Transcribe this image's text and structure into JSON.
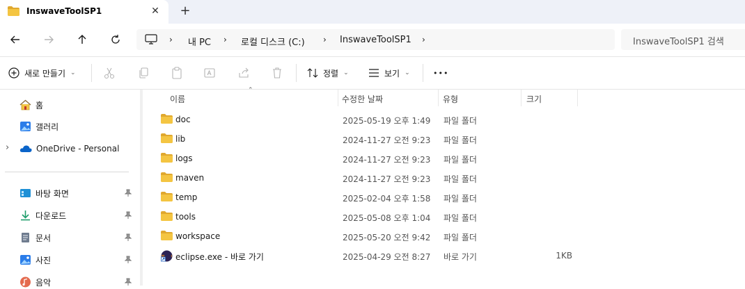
{
  "window": {
    "tab_title": "InswaveToolSP1",
    "close_glyph": "✕",
    "new_tab_glyph": "+"
  },
  "nav": {
    "breadcrumbs": [
      "내 PC",
      "로컬 디스크 (C:)",
      "InswaveToolSP1"
    ],
    "chevron": "›",
    "search_placeholder": "InswaveToolSP1 검색"
  },
  "toolbar": {
    "new_label": "새로 만들기",
    "sort_label": "정렬",
    "view_label": "보기",
    "more_glyph": "•••",
    "caret": "⌄"
  },
  "sidebar": {
    "items": [
      {
        "label": "홈",
        "icon": "home-icon"
      },
      {
        "label": "갤러리",
        "icon": "gallery-icon"
      },
      {
        "label": "OneDrive - Personal",
        "icon": "onedrive-icon"
      }
    ],
    "pinned": [
      {
        "label": "바탕 화면",
        "icon": "desktop-icon"
      },
      {
        "label": "다운로드",
        "icon": "download-icon"
      },
      {
        "label": "문서",
        "icon": "document-icon"
      },
      {
        "label": "사진",
        "icon": "pictures-icon"
      },
      {
        "label": "음악",
        "icon": "music-icon"
      }
    ],
    "expand_glyph": "›",
    "pin_glyph": "📌"
  },
  "columns": {
    "name": "이름",
    "modified": "수정한 날짜",
    "type": "유형",
    "size": "크기",
    "sort_glyph": "⌃"
  },
  "files": [
    {
      "name": "doc",
      "modified": "2025-05-19 오후 1:49",
      "type": "파일 폴더",
      "size": "",
      "icon": "folder-icon"
    },
    {
      "name": "lib",
      "modified": "2024-11-27 오전 9:23",
      "type": "파일 폴더",
      "size": "",
      "icon": "folder-icon"
    },
    {
      "name": "logs",
      "modified": "2024-11-27 오전 9:23",
      "type": "파일 폴더",
      "size": "",
      "icon": "folder-icon"
    },
    {
      "name": "maven",
      "modified": "2024-11-27 오전 9:23",
      "type": "파일 폴더",
      "size": "",
      "icon": "folder-icon"
    },
    {
      "name": "temp",
      "modified": "2025-02-04 오후 1:58",
      "type": "파일 폴더",
      "size": "",
      "icon": "folder-icon"
    },
    {
      "name": "tools",
      "modified": "2025-05-08 오후 1:04",
      "type": "파일 폴더",
      "size": "",
      "icon": "folder-icon"
    },
    {
      "name": "workspace",
      "modified": "2025-05-20 오전 9:42",
      "type": "파일 폴더",
      "size": "",
      "icon": "folder-icon"
    },
    {
      "name": "eclipse.exe - 바로 가기",
      "modified": "2025-04-29 오전 8:27",
      "type": "바로 가기",
      "size": "1KB",
      "icon": "eclipse-shortcut-icon"
    }
  ],
  "colors": {
    "folder": "#f4c542",
    "folder_dark": "#e0a82e",
    "accent": "#0067c0",
    "title_bar": "#eef1f8"
  }
}
